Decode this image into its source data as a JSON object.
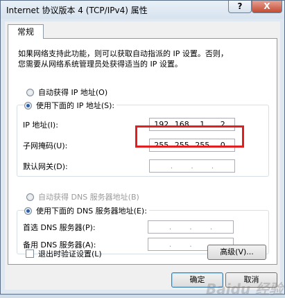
{
  "window": {
    "title": "Internet 协议版本 4 (TCP/IPv4) 属性",
    "help_label": "?",
    "close_label": "X"
  },
  "tab": {
    "label": "常规"
  },
  "description": {
    "line1": "如果网络支持此功能，则可以获取自动指派的 IP 设置。否则，",
    "line2": "您需要从网络系统管理员处获得适当的 IP 设置。"
  },
  "ip": {
    "auto_label": "自动获得 IP 地址(O)",
    "manual_label": "使用下面的 IP 地址(S):",
    "address_label": "IP 地址(I):",
    "address": [
      "192",
      "168",
      "1",
      "2"
    ],
    "subnet_label": "子网掩码(U):",
    "subnet": [
      "255",
      "255",
      "255",
      "0"
    ],
    "gateway_label": "默认网关(D):",
    "gateway": [
      "",
      "",
      "",
      ""
    ]
  },
  "dns": {
    "auto_label": "自动获得 DNS 服务器地址(B)",
    "manual_label": "使用下面的 DNS 服务器地址(E):",
    "preferred_label": "首选 DNS 服务器(P):",
    "preferred": [
      "",
      "",
      "",
      ""
    ],
    "alternate_label": "备用 DNS 服务器(A):",
    "alternate": [
      "",
      "",
      "",
      ""
    ]
  },
  "validate_label": "退出时验证设置(L)",
  "buttons": {
    "advanced": "高级(V)...",
    "ok": "确定",
    "cancel": "取消"
  },
  "watermark": "Baidu 经验",
  "colors": {
    "highlight_border": "#e02020",
    "radio_selected": "#2a5ea8"
  }
}
